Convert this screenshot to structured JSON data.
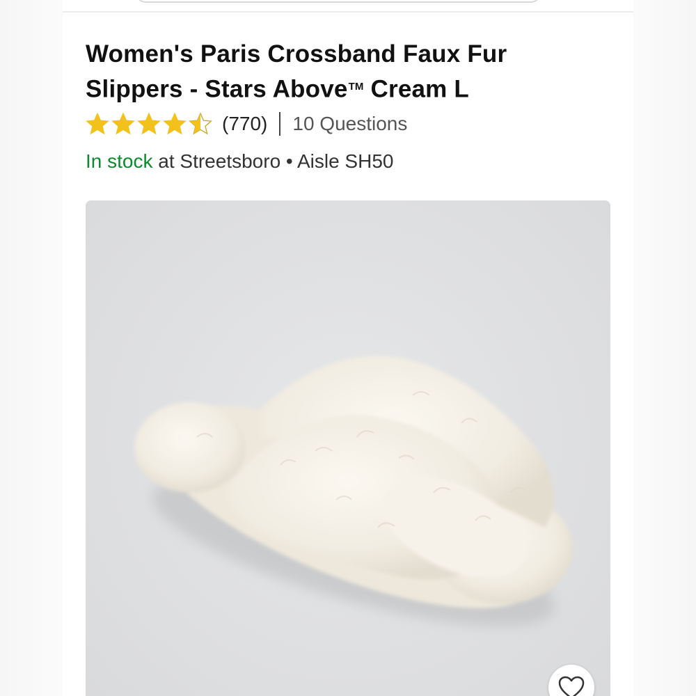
{
  "product": {
    "title_main": "Women's Paris Crossband Faux Fur Slippers - Stars Above",
    "title_tm": "TM",
    "title_tail": " Cream L",
    "rating": 4.5,
    "rating_max": 5,
    "review_count": "(770)",
    "questions": "10 Questions"
  },
  "availability": {
    "status": "In stock",
    "location": " at Streetsboro • Aisle SH50"
  },
  "image": {
    "icon": "heart-icon"
  },
  "colors": {
    "star": "#f2c21b",
    "in_stock": "#0c8a2d",
    "image_bg": "#dedfe1"
  }
}
